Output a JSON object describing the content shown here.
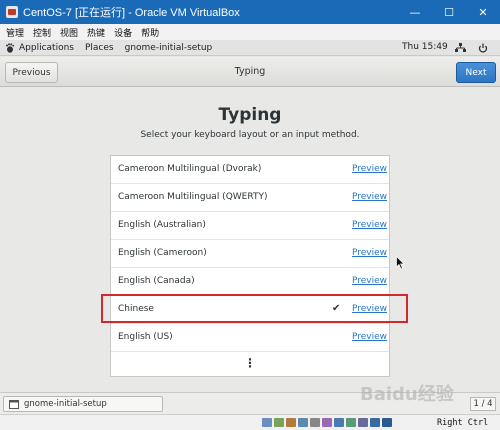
{
  "window": {
    "title": "CentOS-7 [正在运行] - Oracle VM VirtualBox",
    "minimize_glyph": "—",
    "maximize_glyph": "☐",
    "close_glyph": "✕"
  },
  "vbox_menu": [
    "管理",
    "控制",
    "视图",
    "热键",
    "设备",
    "帮助"
  ],
  "gnome_topbar": {
    "applications": "Applications",
    "places": "Places",
    "app_name": "gnome-initial-setup",
    "clock": "Thu 15:49"
  },
  "header": {
    "previous_label": "Previous",
    "title": "Typing",
    "next_label": "Next"
  },
  "main": {
    "heading": "Typing",
    "subtitle": "Select your keyboard layout or an input method.",
    "layouts": [
      {
        "name": "Cameroon Multilingual (Dvorak)",
        "preview": "Preview",
        "selected": false
      },
      {
        "name": "Cameroon Multilingual (QWERTY)",
        "preview": "Preview",
        "selected": false
      },
      {
        "name": "English (Australian)",
        "preview": "Preview",
        "selected": false
      },
      {
        "name": "English (Cameroon)",
        "preview": "Preview",
        "selected": false
      },
      {
        "name": "English (Canada)",
        "preview": "Preview",
        "selected": false
      },
      {
        "name": "Chinese",
        "preview": "Preview",
        "selected": true
      },
      {
        "name": "English (US)",
        "preview": "Preview",
        "selected": false
      }
    ],
    "selected_mark": "✔",
    "more_glyph": "⋮"
  },
  "taskbar": {
    "task_label": "gnome-initial-setup",
    "workspace": "1 / 4"
  },
  "statusbar": {
    "host_key": "Right Ctrl"
  },
  "watermark": "Baidu经验",
  "colors": {
    "titlebar": "#1b6ab7",
    "next_button": "#2d76c6",
    "link": "#2a76c6",
    "highlight": "#d0282b"
  }
}
